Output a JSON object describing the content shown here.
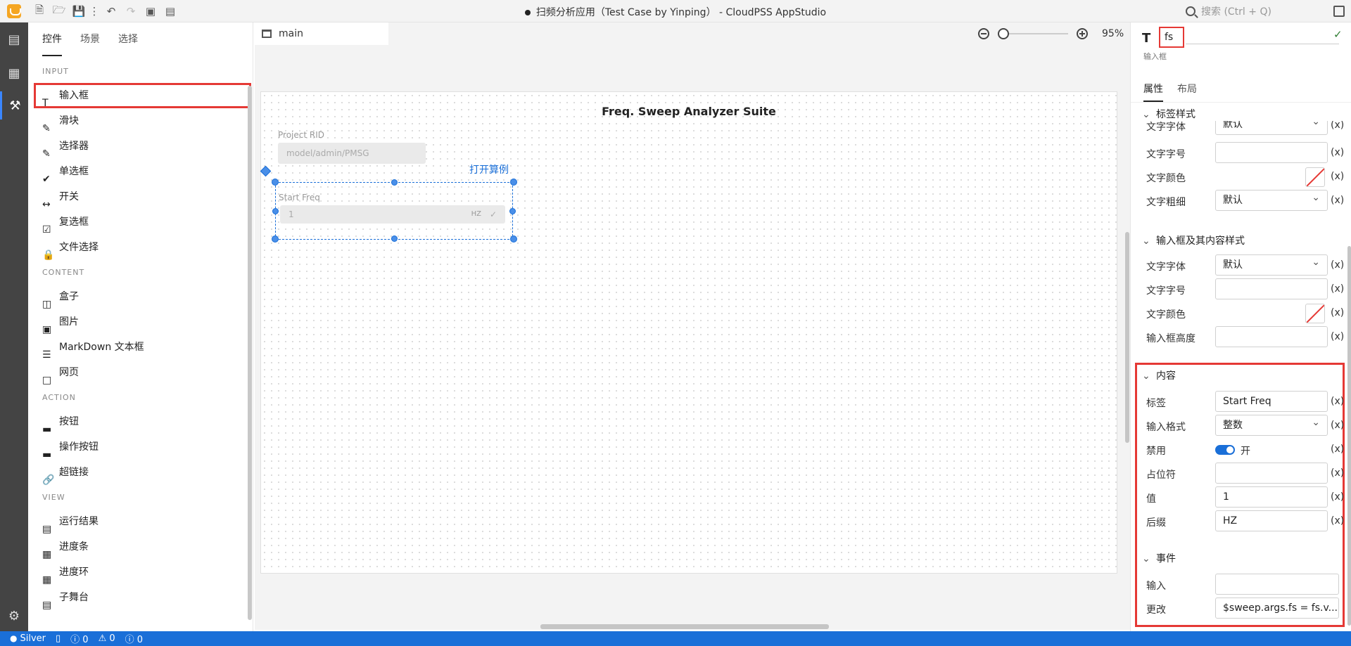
{
  "window": {
    "title": "扫频分析应用（Test Case by Yinping） - CloudPSS AppStudio",
    "search_placeholder": "搜索 (Ctrl + Q)"
  },
  "sidebar": {
    "tabs": [
      "控件",
      "场景",
      "选择"
    ],
    "categories": {
      "input": "INPUT",
      "content": "CONTENT",
      "action": "ACTION",
      "view": "VIEW"
    },
    "input_items": [
      "输入框",
      "滑块",
      "选择器",
      "单选框",
      "开关",
      "复选框",
      "文件选择"
    ],
    "content_items": [
      "盒子",
      "图片",
      "MarkDown 文本框",
      "网页"
    ],
    "action_items": [
      "按钮",
      "操作按钮",
      "超链接"
    ],
    "view_items": [
      "运行结果",
      "进度条",
      "进度环",
      "子舞台"
    ]
  },
  "editor": {
    "tab": "main",
    "zoom": "95%",
    "canvas": {
      "title": "Freq. Sweep Analyzer Suite",
      "project_label": "Project RID",
      "project_placeholder": "model/admin/PMSG",
      "open_link": "打开算例",
      "freq_label": "Start Freq",
      "freq_value": "1",
      "freq_suffix": "HZ"
    }
  },
  "props": {
    "component_id": "fs",
    "component_type": "输入框",
    "tabs": [
      "属性",
      "布局"
    ],
    "sections": {
      "label_style": "标签样式",
      "input_style": "输入框及其内容样式",
      "content": "内容",
      "events": "事件"
    },
    "label_style_rows": {
      "font_partial": "文字字体",
      "font_partial_val": "默认",
      "size": "文字字号",
      "color": "文字颜色",
      "weight": "文字粗细",
      "weight_val": "默认"
    },
    "input_style_rows": {
      "font": "文字字体",
      "font_val": "默认",
      "size": "文字字号",
      "color": "文字颜色",
      "height": "输入框高度"
    },
    "content_rows": {
      "label": "标签",
      "label_val": "Start Freq",
      "format": "输入格式",
      "format_val": "整数",
      "disabled": "禁用",
      "disabled_val": "开",
      "placeholder": "占位符",
      "value": "值",
      "value_val": "1",
      "suffix": "后缀",
      "suffix_val": "HZ"
    },
    "event_rows": {
      "input": "输入",
      "change": "更改",
      "change_val": "$sweep.args.fs = fs.v..."
    },
    "expr_marker": "(x)"
  },
  "status": {
    "user": "Silver",
    "errors": "0",
    "warnings": "0",
    "infos": "0"
  }
}
